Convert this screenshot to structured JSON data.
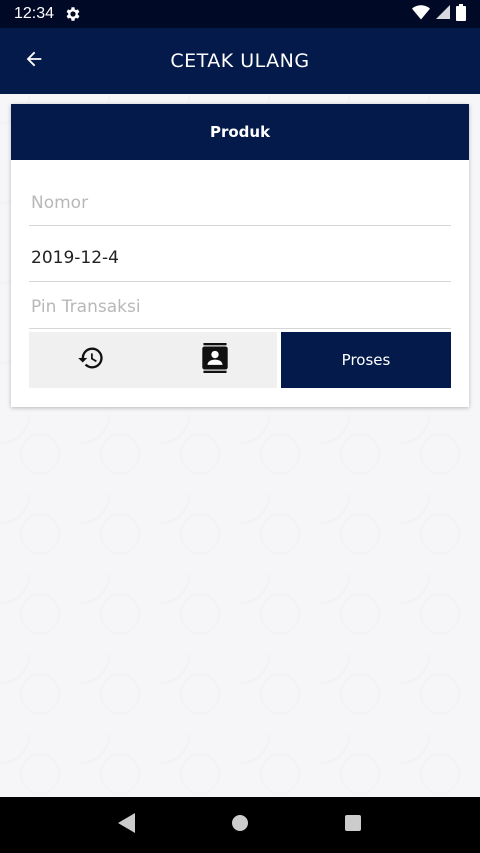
{
  "status_bar": {
    "time": "12:34"
  },
  "app_bar": {
    "title": "CETAK ULANG"
  },
  "card": {
    "header": "Produk",
    "fields": {
      "nomor": {
        "value": "",
        "placeholder": "Nomor"
      },
      "date": {
        "value": "2019-12-4",
        "placeholder": ""
      },
      "pin": {
        "value": "",
        "placeholder": "Pin Transaksi"
      }
    },
    "proses_label": "Proses"
  },
  "icons": {
    "back": "arrow-left-icon",
    "history": "history-icon",
    "contacts": "contacts-icon",
    "settings": "gear-icon"
  },
  "colors": {
    "primary": "#041a4a",
    "status_bar": "#000a26"
  }
}
